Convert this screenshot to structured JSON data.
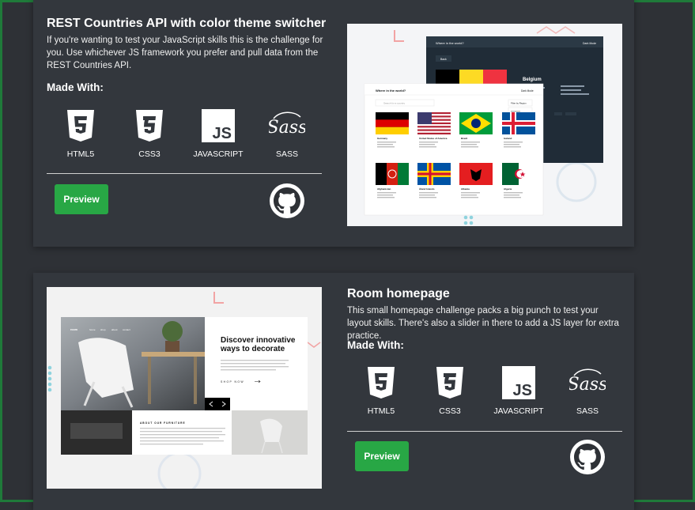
{
  "projects": [
    {
      "title": "REST Countries API with color theme switcher",
      "description": "If you're wanting to test your JavaScript skills this is the challenge for you. Use whichever JS framework you prefer and pull data from the REST Countries API.",
      "made_with_label": "Made With:",
      "tech": [
        "HTML5",
        "CSS3",
        "JAVASCRIPT",
        "SASS"
      ],
      "preview_label": "Preview",
      "screenshot": {
        "dark_title": "Where in the world?",
        "dark_mode": "Dark Mode",
        "back": "Back",
        "detail_country": "Belgium",
        "light_title": "Where in the world?",
        "light_mode": "Dark Mode",
        "search_placeholder": "Search for a country",
        "filter_label": "Filter by Region",
        "countries": [
          "Germany",
          "United States of America",
          "Brazil",
          "Iceland",
          "Afghanistan",
          "Åland Islands",
          "Albania",
          "Algeria"
        ]
      }
    },
    {
      "title": "Room homepage",
      "description": "This small homepage challenge packs a big punch to test your layout skills. There's also a slider in there to add a JS layer for extra practice.",
      "made_with_label": "Made With:",
      "tech": [
        "HTML5",
        "CSS3",
        "JAVASCRIPT",
        "SASS"
      ],
      "preview_label": "Preview",
      "screenshot": {
        "logo": "room",
        "nav": [
          "home",
          "shop",
          "about",
          "contact"
        ],
        "headline": "Discover innovative ways to decorate",
        "cta": "SHOP NOW",
        "about_heading": "ABOUT OUR FURNITURE"
      }
    }
  ],
  "colors": {
    "accent": "#28a745",
    "card": "#33373d",
    "background": "#2e3136"
  },
  "icons": [
    "html5-icon",
    "css3-icon",
    "javascript-icon",
    "sass-icon",
    "github-icon"
  ]
}
